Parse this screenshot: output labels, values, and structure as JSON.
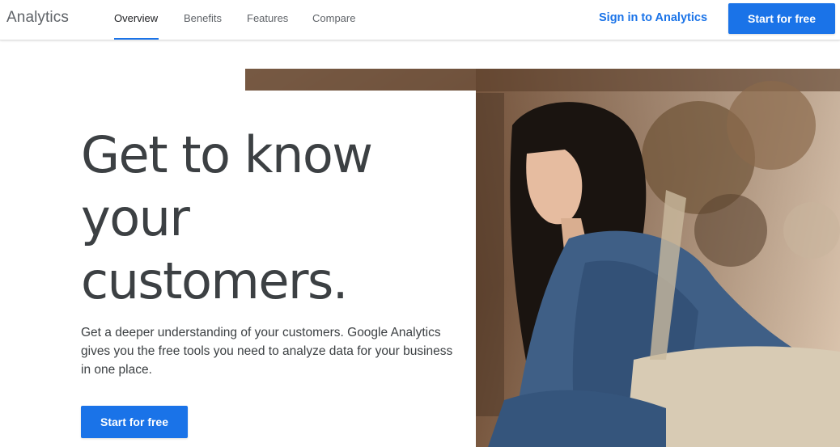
{
  "header": {
    "logo": "Analytics",
    "nav": [
      "Overview",
      "Benefits",
      "Features",
      "Compare"
    ],
    "active_nav": "Overview",
    "signin_label": "Sign in to Analytics",
    "cta_label": "Start for free"
  },
  "hero": {
    "headline_lines": [
      "Get to know",
      "your",
      "customers."
    ],
    "subtext": "Get a deeper understanding of your customers. Google Analytics gives you the free tools you need to analyze data for your business in one place.",
    "cta_label": "Start for free"
  },
  "colors": {
    "accent": "#1a73e8",
    "text": "#3c4043"
  }
}
